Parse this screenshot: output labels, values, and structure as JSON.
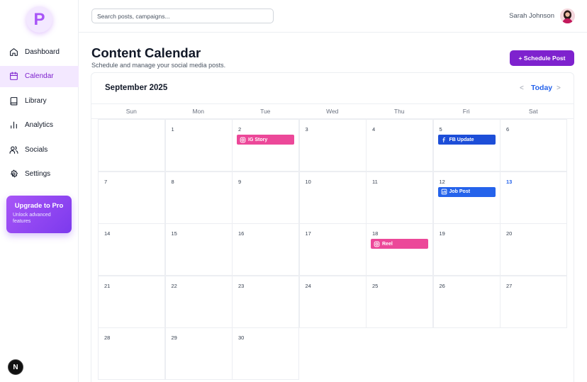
{
  "app": {
    "logo_letter": "P"
  },
  "sidebar": {
    "items": [
      {
        "label": "Dashboard",
        "icon": "home-icon",
        "active": false
      },
      {
        "label": "Calendar",
        "icon": "calendar-icon",
        "active": true
      },
      {
        "label": "Library",
        "icon": "book-icon",
        "active": false
      },
      {
        "label": "Analytics",
        "icon": "bar-chart-icon",
        "active": false
      },
      {
        "label": "Socials",
        "icon": "users-icon",
        "active": false
      },
      {
        "label": "Settings",
        "icon": "gear-icon",
        "active": false
      }
    ],
    "upgrade": {
      "title": "Upgrade to Pro",
      "subtitle": "Unlock advanced features"
    },
    "bubble_letter": "N"
  },
  "header": {
    "search_placeholder": "Search posts, campaigns...",
    "user_name": "Sarah Johnson"
  },
  "main": {
    "title": "Content Calendar",
    "subtitle": "Schedule and manage your social media posts.",
    "schedule_button": "+ Schedule Post"
  },
  "calendar": {
    "month_label": "September 2025",
    "prev": "<",
    "today_label": "Today",
    "next": ">",
    "weekdays": [
      "Sun",
      "Mon",
      "Tue",
      "Wed",
      "Thu",
      "Fri",
      "Sat"
    ],
    "today_day": "13",
    "weeks": [
      [
        "",
        "1",
        "2",
        "3",
        "4",
        "5",
        "6"
      ],
      [
        "7",
        "8",
        "9",
        "10",
        "11",
        "12",
        "13"
      ],
      [
        "14",
        "15",
        "16",
        "17",
        "18",
        "19",
        "20"
      ],
      [
        "21",
        "22",
        "23",
        "24",
        "25",
        "26",
        "27"
      ],
      [
        "28",
        "29",
        "30"
      ]
    ],
    "events": [
      {
        "day": "2",
        "label": "IG Story",
        "icon": "instagram-icon",
        "color": "#ec4899"
      },
      {
        "day": "5",
        "label": "FB Update",
        "icon": "facebook-icon",
        "color": "#1d4ed8"
      },
      {
        "day": "12",
        "label": "Job Post",
        "icon": "linkedin-icon",
        "color": "#2563eb"
      },
      {
        "day": "18",
        "label": "Reel",
        "icon": "instagram-icon",
        "color": "#ec4899"
      }
    ]
  },
  "colors": {
    "accent": "#7e22ce",
    "active_bg": "#f3e8ff",
    "link": "#2563eb"
  }
}
